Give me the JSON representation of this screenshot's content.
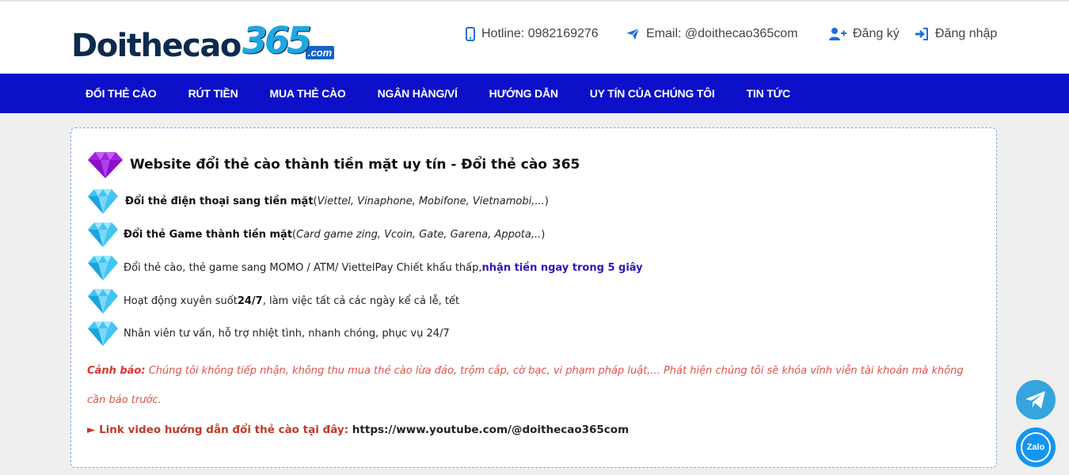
{
  "brand": {
    "logo_main": "Doithecao",
    "logo_num": "365",
    "logo_domain": ".com"
  },
  "header": {
    "hotline_label": "Hotline: 0982169276",
    "email_label": "Email: @doithecao365com",
    "register_label": "Đăng ký",
    "login_label": "Đăng nhập"
  },
  "nav": {
    "items": [
      "ĐỔI THẺ CÀO",
      "RÚT TIỀN",
      "MUA THẺ CÀO",
      "NGÂN HÀNG/VÍ",
      "HƯỚNG DẪN",
      "UY TÍN CỦA CHÚNG TÔI",
      "TIN TỨC"
    ]
  },
  "content": {
    "headline": "Website đổi thẻ cào thành tiền mặt uy tín - Đổi thẻ cào 365",
    "f1_bold": "Đổi thẻ điện thoại sang tiền mặt",
    "f1_open": " (",
    "f1_italic": "Viettel, Vinaphone, Mobifone, Vietnamobi,...",
    "f1_close": ")",
    "f2_bold": "Đổi thẻ Game thành tiền mặt",
    "f2_open": " (",
    "f2_italic": "Card game zing, Vcoin, Gate, Garena, Appota,..",
    "f2_close": ")",
    "f3_text": "Đổi thẻ cào, thẻ game sang MOMO / ATM/ ViettelPay Chiết khấu thấp, ",
    "f3_highlight": "nhận tiền ngay trong 5 giây",
    "f4_pre": "Hoạt động xuyên suốt ",
    "f4_bold": "24/7",
    "f4_post": ", làm việc tất cả các ngày kể cả lễ, tết",
    "f5_text": "Nhân viên tư vấn, hỗ trợ nhiệt tình, nhanh chóng, phục vụ 24/7",
    "warning_label": "Cảnh báo:",
    "warning_text": " Chúng tôi không tiếp nhận, không thu mua thẻ cào lừa đảo, trộm cắp, cờ bạc, vi phạm pháp luật,... Phát hiện chúng tôi sẽ khóa vĩnh viễn tài khoản mà không cần báo trước.",
    "video_label": "► Link video hướng dẫn đổi thẻ cào tại đây:",
    "video_url": " https://www.youtube.com/@doithecao365com"
  },
  "floating": {
    "zalo_label": "Zalo"
  },
  "icons": [
    "phone-icon",
    "paper-plane-icon",
    "user-plus-icon",
    "sign-in-icon",
    "diamond-icon",
    "telegram-icon",
    "zalo-icon"
  ],
  "colors": {
    "nav_bg": "#0c10c9",
    "accent_blue": "#1e6fd6",
    "warning_red": "#e0524d",
    "highlight": "#2a1ab8"
  }
}
